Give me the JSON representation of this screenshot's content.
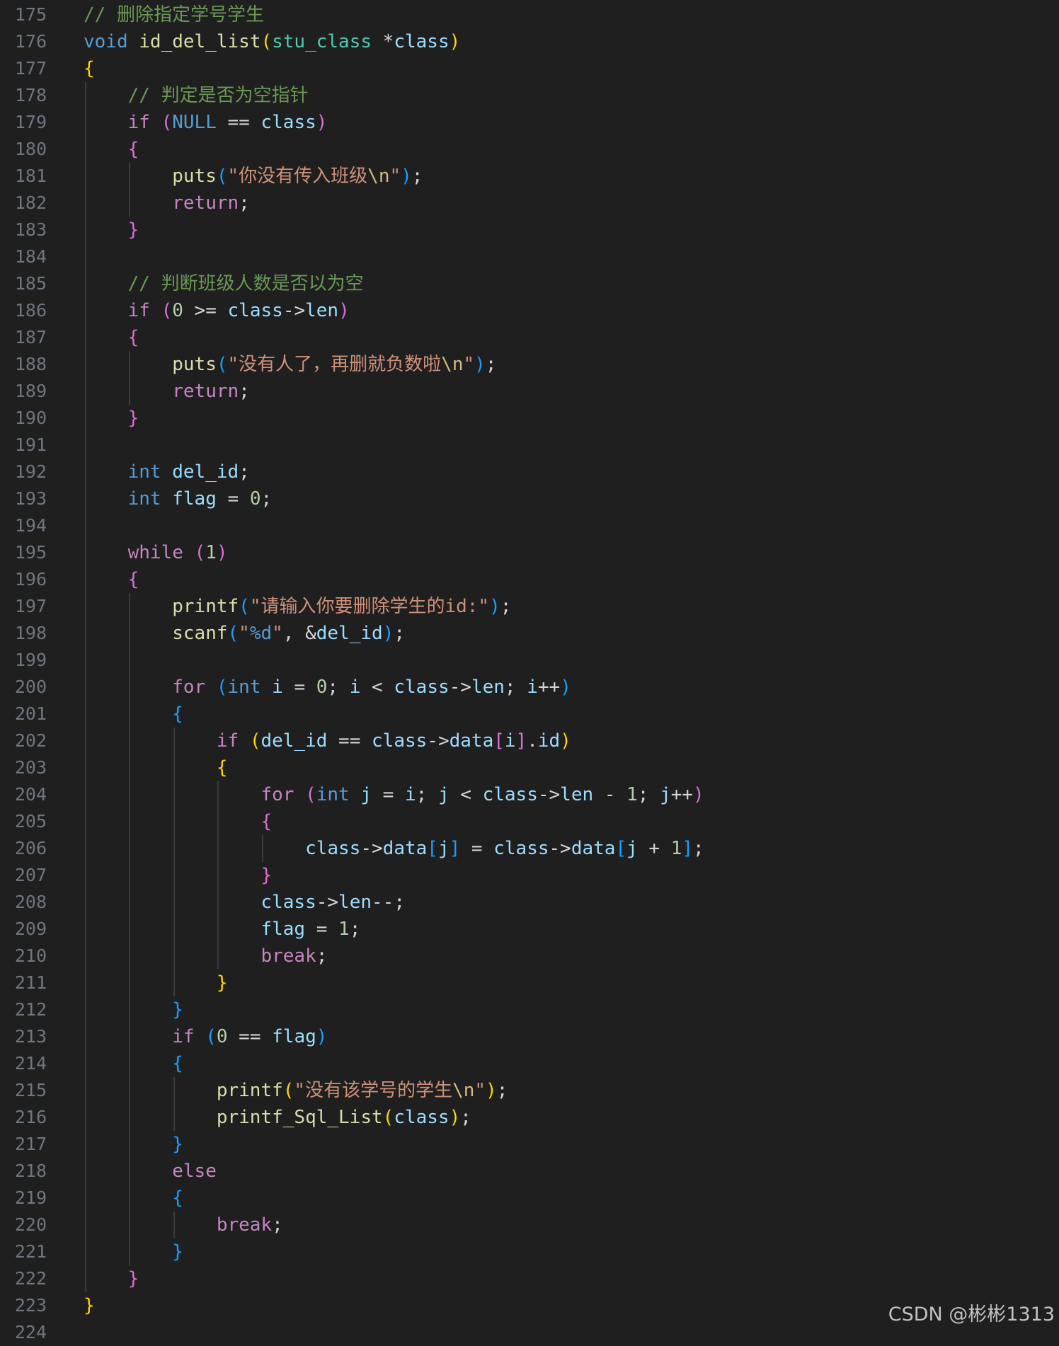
{
  "editor": {
    "theme": {
      "background": "#1f1f1f",
      "line_number": "#6e7681",
      "comment": "#6a9955",
      "keyword": "#569cd6",
      "control": "#c586c0",
      "function": "#dcdcaa",
      "variable": "#9cdcfe",
      "type_name": "#4ec9b0",
      "string": "#ce9178",
      "number": "#b5cea8",
      "bracket_1": "#ffd700",
      "bracket_2": "#da70d6",
      "bracket_3": "#179fff"
    },
    "lines": [
      {
        "n": "175",
        "tokens": [
          [
            "//",
            "c"
          ],
          [
            " 删除指定学号学生",
            "c"
          ]
        ]
      },
      {
        "n": "176",
        "tokens": [
          [
            "void",
            "t"
          ],
          [
            " ",
            ""
          ],
          [
            "id_del_list",
            "f"
          ],
          [
            "(",
            "p1"
          ],
          [
            "stu_class",
            "k"
          ],
          [
            " *",
            "o"
          ],
          [
            "class",
            "v"
          ],
          [
            ")",
            "p1"
          ]
        ]
      },
      {
        "n": "177",
        "tokens": [
          [
            "{",
            "p1"
          ]
        ]
      },
      {
        "n": "178",
        "tokens": [
          [
            "    ",
            ""
          ],
          [
            "// 判定是否为空指针",
            "c"
          ]
        ]
      },
      {
        "n": "179",
        "tokens": [
          [
            "    ",
            ""
          ],
          [
            "if",
            "x"
          ],
          [
            " ",
            ""
          ],
          [
            "(",
            "p2"
          ],
          [
            "NULL",
            "t"
          ],
          [
            " == ",
            "o"
          ],
          [
            "class",
            "v"
          ],
          [
            ")",
            "p2"
          ]
        ]
      },
      {
        "n": "180",
        "tokens": [
          [
            "    ",
            ""
          ],
          [
            "{",
            "p2"
          ]
        ]
      },
      {
        "n": "181",
        "tokens": [
          [
            "        ",
            ""
          ],
          [
            "puts",
            "f"
          ],
          [
            "(",
            "p3"
          ],
          [
            "\"你没有传入班级",
            "s"
          ],
          [
            "\\n",
            "e"
          ],
          [
            "\"",
            "s"
          ],
          [
            ")",
            "p3"
          ],
          [
            ";",
            "o"
          ]
        ]
      },
      {
        "n": "182",
        "tokens": [
          [
            "        ",
            ""
          ],
          [
            "return",
            "x"
          ],
          [
            ";",
            "o"
          ]
        ]
      },
      {
        "n": "183",
        "tokens": [
          [
            "    ",
            ""
          ],
          [
            "}",
            "p2"
          ]
        ]
      },
      {
        "n": "184",
        "tokens": []
      },
      {
        "n": "185",
        "tokens": [
          [
            "    ",
            ""
          ],
          [
            "// 判断班级人数是否以为空",
            "c"
          ]
        ]
      },
      {
        "n": "186",
        "tokens": [
          [
            "    ",
            ""
          ],
          [
            "if",
            "x"
          ],
          [
            " ",
            ""
          ],
          [
            "(",
            "p2"
          ],
          [
            "0",
            "d"
          ],
          [
            " >= ",
            "o"
          ],
          [
            "class",
            "v"
          ],
          [
            "->",
            "o"
          ],
          [
            "len",
            "v"
          ],
          [
            ")",
            "p2"
          ]
        ]
      },
      {
        "n": "187",
        "tokens": [
          [
            "    ",
            ""
          ],
          [
            "{",
            "p2"
          ]
        ]
      },
      {
        "n": "188",
        "tokens": [
          [
            "        ",
            ""
          ],
          [
            "puts",
            "f"
          ],
          [
            "(",
            "p3"
          ],
          [
            "\"没有人了，再删就负数啦",
            "s"
          ],
          [
            "\\n",
            "e"
          ],
          [
            "\"",
            "s"
          ],
          [
            ")",
            "p3"
          ],
          [
            ";",
            "o"
          ]
        ]
      },
      {
        "n": "189",
        "tokens": [
          [
            "        ",
            ""
          ],
          [
            "return",
            "x"
          ],
          [
            ";",
            "o"
          ]
        ]
      },
      {
        "n": "190",
        "tokens": [
          [
            "    ",
            ""
          ],
          [
            "}",
            "p2"
          ]
        ]
      },
      {
        "n": "191",
        "tokens": []
      },
      {
        "n": "192",
        "tokens": [
          [
            "    ",
            ""
          ],
          [
            "int",
            "t"
          ],
          [
            " ",
            ""
          ],
          [
            "del_id",
            "v"
          ],
          [
            ";",
            "o"
          ]
        ]
      },
      {
        "n": "193",
        "tokens": [
          [
            "    ",
            ""
          ],
          [
            "int",
            "t"
          ],
          [
            " ",
            ""
          ],
          [
            "flag",
            "v"
          ],
          [
            " = ",
            "o"
          ],
          [
            "0",
            "d"
          ],
          [
            ";",
            "o"
          ]
        ]
      },
      {
        "n": "194",
        "tokens": []
      },
      {
        "n": "195",
        "tokens": [
          [
            "    ",
            ""
          ],
          [
            "while",
            "x"
          ],
          [
            " ",
            ""
          ],
          [
            "(",
            "p2"
          ],
          [
            "1",
            "d"
          ],
          [
            ")",
            "p2"
          ]
        ]
      },
      {
        "n": "196",
        "tokens": [
          [
            "    ",
            ""
          ],
          [
            "{",
            "p2"
          ]
        ]
      },
      {
        "n": "197",
        "tokens": [
          [
            "        ",
            ""
          ],
          [
            "printf",
            "f"
          ],
          [
            "(",
            "p3"
          ],
          [
            "\"请输入你要删除学生的id:\"",
            "s"
          ],
          [
            ")",
            "p3"
          ],
          [
            ";",
            "o"
          ]
        ]
      },
      {
        "n": "198",
        "tokens": [
          [
            "        ",
            ""
          ],
          [
            "scanf",
            "f"
          ],
          [
            "(",
            "p3"
          ],
          [
            "\"",
            "s"
          ],
          [
            "%d",
            "t"
          ],
          [
            "\"",
            "s"
          ],
          [
            ", &",
            "o"
          ],
          [
            "del_id",
            "v"
          ],
          [
            ")",
            "p3"
          ],
          [
            ";",
            "o"
          ]
        ]
      },
      {
        "n": "199",
        "tokens": []
      },
      {
        "n": "200",
        "tokens": [
          [
            "        ",
            ""
          ],
          [
            "for",
            "x"
          ],
          [
            " ",
            ""
          ],
          [
            "(",
            "p3"
          ],
          [
            "int",
            "t"
          ],
          [
            " ",
            ""
          ],
          [
            "i",
            "v"
          ],
          [
            " = ",
            "o"
          ],
          [
            "0",
            "d"
          ],
          [
            "; ",
            "o"
          ],
          [
            "i",
            "v"
          ],
          [
            " < ",
            "o"
          ],
          [
            "class",
            "v"
          ],
          [
            "->",
            "o"
          ],
          [
            "len",
            "v"
          ],
          [
            "; ",
            "o"
          ],
          [
            "i",
            "v"
          ],
          [
            "++",
            "o"
          ],
          [
            ")",
            "p3"
          ]
        ]
      },
      {
        "n": "201",
        "tokens": [
          [
            "        ",
            ""
          ],
          [
            "{",
            "p3"
          ]
        ]
      },
      {
        "n": "202",
        "tokens": [
          [
            "            ",
            ""
          ],
          [
            "if",
            "x"
          ],
          [
            " ",
            ""
          ],
          [
            "(",
            "p1"
          ],
          [
            "del_id",
            "v"
          ],
          [
            " == ",
            "o"
          ],
          [
            "class",
            "v"
          ],
          [
            "->",
            "o"
          ],
          [
            "data",
            "v"
          ],
          [
            "[",
            "p2"
          ],
          [
            "i",
            "v"
          ],
          [
            "]",
            "p2"
          ],
          [
            ".",
            "o"
          ],
          [
            "id",
            "v"
          ],
          [
            ")",
            "p1"
          ]
        ]
      },
      {
        "n": "203",
        "tokens": [
          [
            "            ",
            ""
          ],
          [
            "{",
            "p1"
          ]
        ]
      },
      {
        "n": "204",
        "tokens": [
          [
            "                ",
            ""
          ],
          [
            "for",
            "x"
          ],
          [
            " ",
            ""
          ],
          [
            "(",
            "p2"
          ],
          [
            "int",
            "t"
          ],
          [
            " ",
            ""
          ],
          [
            "j",
            "v"
          ],
          [
            " = ",
            "o"
          ],
          [
            "i",
            "v"
          ],
          [
            "; ",
            "o"
          ],
          [
            "j",
            "v"
          ],
          [
            " < ",
            "o"
          ],
          [
            "class",
            "v"
          ],
          [
            "->",
            "o"
          ],
          [
            "len",
            "v"
          ],
          [
            " - ",
            "o"
          ],
          [
            "1",
            "d"
          ],
          [
            "; ",
            "o"
          ],
          [
            "j",
            "v"
          ],
          [
            "++",
            "o"
          ],
          [
            ")",
            "p2"
          ]
        ]
      },
      {
        "n": "205",
        "tokens": [
          [
            "                ",
            ""
          ],
          [
            "{",
            "p2"
          ]
        ]
      },
      {
        "n": "206",
        "tokens": [
          [
            "                    ",
            ""
          ],
          [
            "class",
            "v"
          ],
          [
            "->",
            "o"
          ],
          [
            "data",
            "v"
          ],
          [
            "[",
            "p3"
          ],
          [
            "j",
            "v"
          ],
          [
            "]",
            "p3"
          ],
          [
            " = ",
            "o"
          ],
          [
            "class",
            "v"
          ],
          [
            "->",
            "o"
          ],
          [
            "data",
            "v"
          ],
          [
            "[",
            "p3"
          ],
          [
            "j",
            "v"
          ],
          [
            " + ",
            "o"
          ],
          [
            "1",
            "d"
          ],
          [
            "]",
            "p3"
          ],
          [
            ";",
            "o"
          ]
        ]
      },
      {
        "n": "207",
        "tokens": [
          [
            "                ",
            ""
          ],
          [
            "}",
            "p2"
          ]
        ]
      },
      {
        "n": "208",
        "tokens": [
          [
            "                ",
            ""
          ],
          [
            "class",
            "v"
          ],
          [
            "->",
            "o"
          ],
          [
            "len",
            "v"
          ],
          [
            "--;",
            "o"
          ]
        ]
      },
      {
        "n": "209",
        "tokens": [
          [
            "                ",
            ""
          ],
          [
            "flag",
            "v"
          ],
          [
            " = ",
            "o"
          ],
          [
            "1",
            "d"
          ],
          [
            ";",
            "o"
          ]
        ]
      },
      {
        "n": "210",
        "tokens": [
          [
            "                ",
            ""
          ],
          [
            "break",
            "x"
          ],
          [
            ";",
            "o"
          ]
        ]
      },
      {
        "n": "211",
        "tokens": [
          [
            "            ",
            ""
          ],
          [
            "}",
            "p1"
          ]
        ]
      },
      {
        "n": "212",
        "tokens": [
          [
            "        ",
            ""
          ],
          [
            "}",
            "p3"
          ]
        ]
      },
      {
        "n": "213",
        "tokens": [
          [
            "        ",
            ""
          ],
          [
            "if",
            "x"
          ],
          [
            " ",
            ""
          ],
          [
            "(",
            "p3"
          ],
          [
            "0",
            "d"
          ],
          [
            " == ",
            "o"
          ],
          [
            "flag",
            "v"
          ],
          [
            ")",
            "p3"
          ]
        ]
      },
      {
        "n": "214",
        "tokens": [
          [
            "        ",
            ""
          ],
          [
            "{",
            "p3"
          ]
        ]
      },
      {
        "n": "215",
        "tokens": [
          [
            "            ",
            ""
          ],
          [
            "printf",
            "f"
          ],
          [
            "(",
            "p1"
          ],
          [
            "\"没有该学号的学生",
            "s"
          ],
          [
            "\\n",
            "e"
          ],
          [
            "\"",
            "s"
          ],
          [
            ")",
            "p1"
          ],
          [
            ";",
            "o"
          ]
        ]
      },
      {
        "n": "216",
        "tokens": [
          [
            "            ",
            ""
          ],
          [
            "printf_Sql_List",
            "f"
          ],
          [
            "(",
            "p1"
          ],
          [
            "class",
            "v"
          ],
          [
            ")",
            "p1"
          ],
          [
            ";",
            "o"
          ]
        ]
      },
      {
        "n": "217",
        "tokens": [
          [
            "        ",
            ""
          ],
          [
            "}",
            "p3"
          ]
        ]
      },
      {
        "n": "218",
        "tokens": [
          [
            "        ",
            ""
          ],
          [
            "else",
            "x"
          ]
        ]
      },
      {
        "n": "219",
        "tokens": [
          [
            "        ",
            ""
          ],
          [
            "{",
            "p3"
          ]
        ]
      },
      {
        "n": "220",
        "tokens": [
          [
            "            ",
            ""
          ],
          [
            "break",
            "x"
          ],
          [
            ";",
            "o"
          ]
        ]
      },
      {
        "n": "221",
        "tokens": [
          [
            "        ",
            ""
          ],
          [
            "}",
            "p3"
          ]
        ]
      },
      {
        "n": "222",
        "tokens": [
          [
            "    ",
            ""
          ],
          [
            "}",
            "p2"
          ]
        ]
      },
      {
        "n": "223",
        "tokens": [
          [
            "}",
            "p1"
          ]
        ]
      },
      {
        "n": "224",
        "tokens": []
      }
    ]
  },
  "watermark": "CSDN @彬彬1313"
}
